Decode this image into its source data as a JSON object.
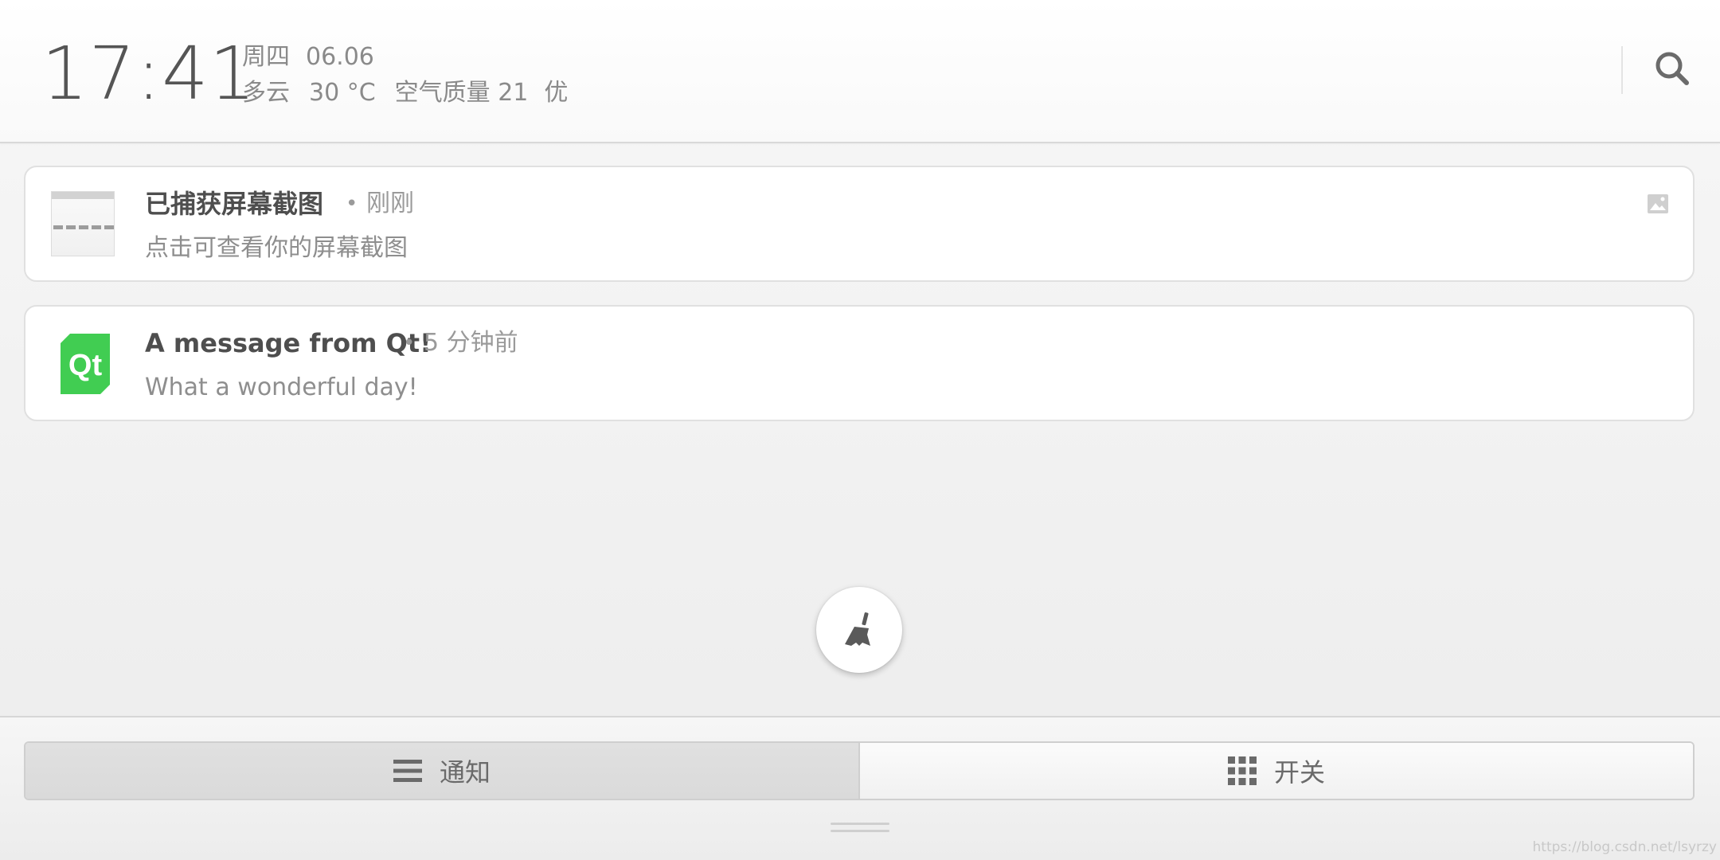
{
  "header": {
    "time": "17:41",
    "weekday": "周四",
    "date": "06.06",
    "weather": "多云",
    "temperature": "30 °C",
    "air_quality_label": "空气质量 21",
    "air_quality_level": "优",
    "search_icon": "search-icon"
  },
  "notifications": [
    {
      "icon": "screenshot-thumbnail",
      "title": "已捕获屏幕截图",
      "separator": "•",
      "time": "刚刚",
      "body": "点击可查看你的屏幕截图",
      "badge_icon": "image-icon"
    },
    {
      "icon": "qt-logo-icon",
      "logo_text": "Qt",
      "title": "A message from Qt!",
      "separator": "•",
      "time": "5 分钟前",
      "body": "What a wonderful day!"
    }
  ],
  "clear_button": {
    "icon": "broom-icon"
  },
  "tabs": [
    {
      "label": "通知",
      "icon": "list-icon",
      "active": true
    },
    {
      "label": "开关",
      "icon": "grid-icon",
      "active": false
    }
  ],
  "watermark": "https://blog.csdn.net/lsyrzy",
  "colors": {
    "qt_green": "#41cd52",
    "text_primary": "#4e4e4e",
    "text_secondary": "#8e8e8e"
  }
}
